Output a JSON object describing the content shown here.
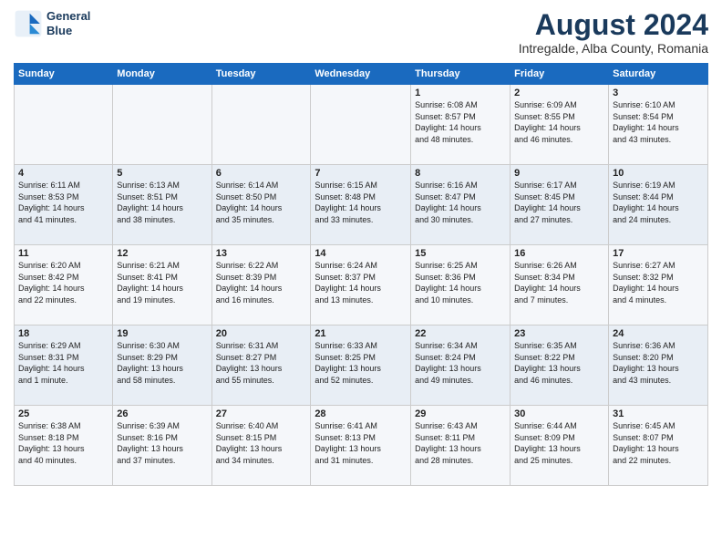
{
  "logo": {
    "line1": "General",
    "line2": "Blue"
  },
  "title": "August 2024",
  "subtitle": "Intregalde, Alba County, Romania",
  "weekdays": [
    "Sunday",
    "Monday",
    "Tuesday",
    "Wednesday",
    "Thursday",
    "Friday",
    "Saturday"
  ],
  "weeks": [
    [
      {
        "day": "",
        "info": ""
      },
      {
        "day": "",
        "info": ""
      },
      {
        "day": "",
        "info": ""
      },
      {
        "day": "",
        "info": ""
      },
      {
        "day": "1",
        "info": "Sunrise: 6:08 AM\nSunset: 8:57 PM\nDaylight: 14 hours\nand 48 minutes."
      },
      {
        "day": "2",
        "info": "Sunrise: 6:09 AM\nSunset: 8:55 PM\nDaylight: 14 hours\nand 46 minutes."
      },
      {
        "day": "3",
        "info": "Sunrise: 6:10 AM\nSunset: 8:54 PM\nDaylight: 14 hours\nand 43 minutes."
      }
    ],
    [
      {
        "day": "4",
        "info": "Sunrise: 6:11 AM\nSunset: 8:53 PM\nDaylight: 14 hours\nand 41 minutes."
      },
      {
        "day": "5",
        "info": "Sunrise: 6:13 AM\nSunset: 8:51 PM\nDaylight: 14 hours\nand 38 minutes."
      },
      {
        "day": "6",
        "info": "Sunrise: 6:14 AM\nSunset: 8:50 PM\nDaylight: 14 hours\nand 35 minutes."
      },
      {
        "day": "7",
        "info": "Sunrise: 6:15 AM\nSunset: 8:48 PM\nDaylight: 14 hours\nand 33 minutes."
      },
      {
        "day": "8",
        "info": "Sunrise: 6:16 AM\nSunset: 8:47 PM\nDaylight: 14 hours\nand 30 minutes."
      },
      {
        "day": "9",
        "info": "Sunrise: 6:17 AM\nSunset: 8:45 PM\nDaylight: 14 hours\nand 27 minutes."
      },
      {
        "day": "10",
        "info": "Sunrise: 6:19 AM\nSunset: 8:44 PM\nDaylight: 14 hours\nand 24 minutes."
      }
    ],
    [
      {
        "day": "11",
        "info": "Sunrise: 6:20 AM\nSunset: 8:42 PM\nDaylight: 14 hours\nand 22 minutes."
      },
      {
        "day": "12",
        "info": "Sunrise: 6:21 AM\nSunset: 8:41 PM\nDaylight: 14 hours\nand 19 minutes."
      },
      {
        "day": "13",
        "info": "Sunrise: 6:22 AM\nSunset: 8:39 PM\nDaylight: 14 hours\nand 16 minutes."
      },
      {
        "day": "14",
        "info": "Sunrise: 6:24 AM\nSunset: 8:37 PM\nDaylight: 14 hours\nand 13 minutes."
      },
      {
        "day": "15",
        "info": "Sunrise: 6:25 AM\nSunset: 8:36 PM\nDaylight: 14 hours\nand 10 minutes."
      },
      {
        "day": "16",
        "info": "Sunrise: 6:26 AM\nSunset: 8:34 PM\nDaylight: 14 hours\nand 7 minutes."
      },
      {
        "day": "17",
        "info": "Sunrise: 6:27 AM\nSunset: 8:32 PM\nDaylight: 14 hours\nand 4 minutes."
      }
    ],
    [
      {
        "day": "18",
        "info": "Sunrise: 6:29 AM\nSunset: 8:31 PM\nDaylight: 14 hours\nand 1 minute."
      },
      {
        "day": "19",
        "info": "Sunrise: 6:30 AM\nSunset: 8:29 PM\nDaylight: 13 hours\nand 58 minutes."
      },
      {
        "day": "20",
        "info": "Sunrise: 6:31 AM\nSunset: 8:27 PM\nDaylight: 13 hours\nand 55 minutes."
      },
      {
        "day": "21",
        "info": "Sunrise: 6:33 AM\nSunset: 8:25 PM\nDaylight: 13 hours\nand 52 minutes."
      },
      {
        "day": "22",
        "info": "Sunrise: 6:34 AM\nSunset: 8:24 PM\nDaylight: 13 hours\nand 49 minutes."
      },
      {
        "day": "23",
        "info": "Sunrise: 6:35 AM\nSunset: 8:22 PM\nDaylight: 13 hours\nand 46 minutes."
      },
      {
        "day": "24",
        "info": "Sunrise: 6:36 AM\nSunset: 8:20 PM\nDaylight: 13 hours\nand 43 minutes."
      }
    ],
    [
      {
        "day": "25",
        "info": "Sunrise: 6:38 AM\nSunset: 8:18 PM\nDaylight: 13 hours\nand 40 minutes."
      },
      {
        "day": "26",
        "info": "Sunrise: 6:39 AM\nSunset: 8:16 PM\nDaylight: 13 hours\nand 37 minutes."
      },
      {
        "day": "27",
        "info": "Sunrise: 6:40 AM\nSunset: 8:15 PM\nDaylight: 13 hours\nand 34 minutes."
      },
      {
        "day": "28",
        "info": "Sunrise: 6:41 AM\nSunset: 8:13 PM\nDaylight: 13 hours\nand 31 minutes."
      },
      {
        "day": "29",
        "info": "Sunrise: 6:43 AM\nSunset: 8:11 PM\nDaylight: 13 hours\nand 28 minutes."
      },
      {
        "day": "30",
        "info": "Sunrise: 6:44 AM\nSunset: 8:09 PM\nDaylight: 13 hours\nand 25 minutes."
      },
      {
        "day": "31",
        "info": "Sunrise: 6:45 AM\nSunset: 8:07 PM\nDaylight: 13 hours\nand 22 minutes."
      }
    ]
  ],
  "colors": {
    "header_bg": "#1a6abf",
    "title_color": "#1a3a5c",
    "odd_row": "#f5f7fa",
    "even_row": "#e8eef5"
  }
}
